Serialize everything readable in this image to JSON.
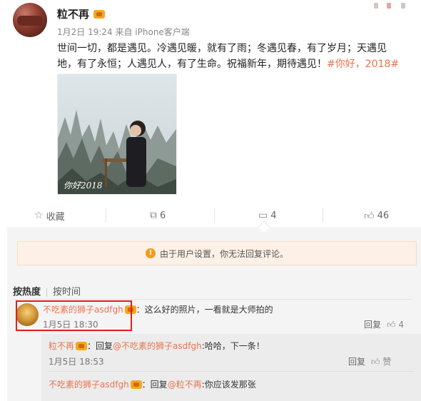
{
  "post": {
    "username": "粒不再",
    "meta": "1月2日 19:24 来自 iPhone客户端",
    "text_line1": "世间一切，都是遇见。冷遇见暖，就有了雨；冬遇见春，有了岁月；天遇见",
    "text_line2_plain": "地，有了永恒；人遇见人，有了生命。祝福新年，期待遇见！",
    "text_line2_tag": "#你好，2018#",
    "photo_watermark": "你好2018"
  },
  "actions": {
    "favorite": "收藏",
    "repost_count": "6",
    "comment_count": "4",
    "like_count": "46"
  },
  "notice": {
    "text": "由于用户设置，你无法回复评论。"
  },
  "sort": {
    "hot": "按热度",
    "time": "按时间"
  },
  "comments": [
    {
      "user": "不吃素的狮子asdfgh",
      "text": "：这么好的照片，一看就是大师拍的",
      "date": "1月5日 18:30",
      "reply_label": "回复",
      "like_label": "4"
    }
  ],
  "replies": [
    {
      "user": "粒不再",
      "prefix": "：回复",
      "mention": "@不吃素的狮子asdfgh",
      "text": ":哈哈，下一条！",
      "date": "1月5日 18:53",
      "reply_label": "回复",
      "like_label": "赞"
    },
    {
      "user": "不吃素的狮子asdfgh",
      "prefix": "：回复",
      "mention": "@粒不再",
      "text": ":你应该发那张"
    }
  ],
  "icons": {
    "favorite": "star-icon",
    "repost": "repost-icon",
    "comment": "comment-icon",
    "like": "thumb-up-icon",
    "vip": "vip-crown-icon",
    "warning": "warning-icon"
  },
  "colors": {
    "accent": "#eb7350",
    "highlight_box": "#e01f1f",
    "notice_bg": "#fdf0e6"
  }
}
